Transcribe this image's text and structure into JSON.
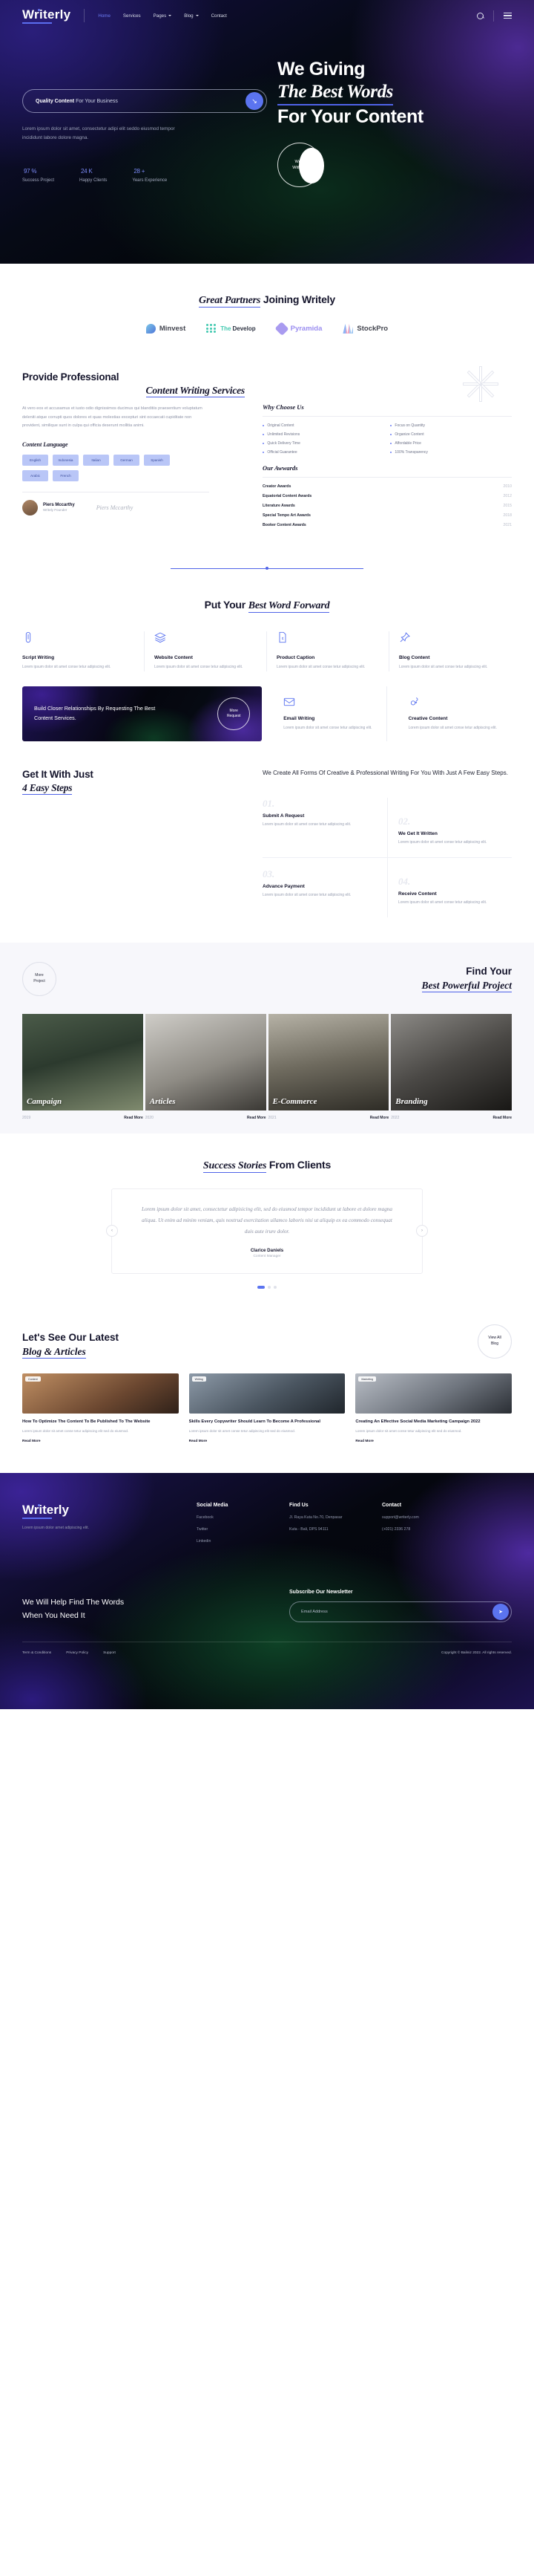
{
  "header": {
    "logo": "Writerly",
    "nav": [
      {
        "label": "Home",
        "active": true,
        "caret": false
      },
      {
        "label": "Services",
        "active": false,
        "caret": false
      },
      {
        "label": "Pages",
        "active": false,
        "caret": true
      },
      {
        "label": "Blog",
        "active": false,
        "caret": true
      },
      {
        "label": "Contact",
        "active": false,
        "caret": false
      }
    ],
    "search_icon": "search-icon",
    "menu_icon": "hamburger-icon"
  },
  "hero": {
    "search_value_bold": "Quality Content",
    "search_value_rest": " For Your Business",
    "submit_icon": "arrow-down-right",
    "description": "Lorem ipsum dolor sit amet, consectetur adipi elit seddo eiusmod tempor incididunt labore dolore magna.",
    "title_line1": "We Giving",
    "title_line2": "The Best Words",
    "title_line3": "For Your Content",
    "badge_line1": "Work",
    "badge_line2": "With Us",
    "stats": [
      {
        "value": "97",
        "unit": "%",
        "label": "Success Project"
      },
      {
        "value": "24",
        "unit": "K",
        "label": "Happy Clients"
      },
      {
        "value": "28",
        "unit": "+",
        "label": "Years Experience"
      }
    ]
  },
  "partners": {
    "title_italic": "Great Partners",
    "title_rest": " Joining Writely",
    "logos": [
      {
        "name": "Minvest"
      },
      {
        "name": "TheDevelop",
        "pre": "The",
        "post": "Develop"
      },
      {
        "name": "Pyramida"
      },
      {
        "name": "StockPro"
      }
    ]
  },
  "services": {
    "heading_line1": "Provide Professional",
    "heading_line2": "Content Writing Services",
    "paragraph": "At vero eos et accusamus et iusto odio dignissimos ducimus qui blanditiis praesentium voluptatum deleniti atque corrupti quos dolores et quas molestias excepturi sint occaecati cupiditate non provident, similique sunt in culpa qui officia deserunt mollitia animi.",
    "content_language_title": "Content Language",
    "languages": [
      "English",
      "Indonesia",
      "Italian",
      "German",
      "Spanish",
      "Arabic",
      "French"
    ],
    "author_name": "Piers Mccarthy",
    "author_role": "Writely Founder",
    "signature": "Piers Mccarthy"
  },
  "why_choose": {
    "title": "Why Choose Us",
    "items": [
      "Original Content",
      "Focus on Quantity",
      "Unlimited Revisions",
      "Organize Content",
      "Quick Delivery Time",
      "Affordable Price",
      "Official Guarantee",
      "100% Transparency"
    ]
  },
  "awards": {
    "title": "Our Awwards",
    "rows": [
      {
        "name": "Creator Awards",
        "year": "2010"
      },
      {
        "name": "Equatorial Content Awards",
        "year": "2012"
      },
      {
        "name": "Literature Awards",
        "year": "2015"
      },
      {
        "name": "Special Tempo Art Awards",
        "year": "2018"
      },
      {
        "name": "Booker Content Awards",
        "year": "2021"
      }
    ]
  },
  "best_word": {
    "title_rest": "Put Your ",
    "title_italic": "Best Word Forward",
    "cards": [
      {
        "icon": "paperclip-icon",
        "title": "Script Writing",
        "text": "Lorem ipsum dolor sit amet conse tetur adipiscing elit."
      },
      {
        "icon": "layers-icon",
        "title": "Website Content",
        "text": "Lorem ipsum dolor sit amet conse tetur adipiscing elit."
      },
      {
        "icon": "document-price-icon",
        "title": "Product Caption",
        "text": "Lorem ipsum dolor sit amet conse tetur adipiscing elit."
      },
      {
        "icon": "pin-icon",
        "title": "Blog Content",
        "text": "Lorem ipsum dolor sit amet conse tetur adipiscing elit."
      }
    ],
    "promo_text": "Build Closer Relationships By Requesting The Best Content Services.",
    "promo_btn_line1": "More",
    "promo_btn_line2": "Request",
    "cards2": [
      {
        "icon": "email-icon",
        "title": "Email Writing",
        "text": "Lorem ipsum dolor sit amet conse tetur adipiscing elit."
      },
      {
        "icon": "idea-icon",
        "title": "Creative Content",
        "text": "Lorem ipsum dolor sit amet conse tetur adipiscing elit."
      }
    ]
  },
  "steps": {
    "heading_line1": "Get It With Just",
    "heading_line2": "4 Easy Steps",
    "lead": "We Create All Forms Of Creative & Professional Writing For You With Just A Few Easy Steps.",
    "items": [
      {
        "num": "01.",
        "title": "Submit A Request",
        "text": "Lorem ipsum dolor sit amet conse tetur adipiscing elit."
      },
      {
        "num": "02.",
        "title": "We Get It Written",
        "text": "Lorem ipsum dolor sit amet conse tetur adipiscing elit."
      },
      {
        "num": "03.",
        "title": "Advance Payment",
        "text": "Lorem ipsum dolor sit amet conse tetur adipiscing elit."
      },
      {
        "num": "04.",
        "title": "Receive Content",
        "text": "Lorem ipsum dolor sit amet conse tetur adipiscing elit."
      }
    ]
  },
  "projects": {
    "more_line1": "More",
    "more_line2": "Project",
    "title_line1": "Find Your",
    "title_line2": "Best Powerful Project",
    "items": [
      {
        "caption": "Campaign",
        "year": "2019",
        "more": "Read More"
      },
      {
        "caption": "Articles",
        "year": "2020",
        "more": "Read More"
      },
      {
        "caption": "E-Commerce",
        "year": "2021",
        "more": "Read More"
      },
      {
        "caption": "Branding",
        "year": "2022",
        "more": "Read More"
      }
    ]
  },
  "testimonial": {
    "title_italic": "Success Stories",
    "title_rest": " From Clients",
    "quote": "Lorem ipsum dolor sit amet, consectetur adipisicing elit, sed do eiusmod tempor incididunt ut labore et dolore magna aliqua. Ut enim ad minim veniam, quis nostrud exercitation ullamco laboris nisi ut aliquip ex ea commodo consequat duis aute irure dolor.",
    "name": "Clarice Daniels",
    "role": "Content Manager",
    "prev_icon": "chevron-left-icon",
    "next_icon": "chevron-right-icon"
  },
  "blog": {
    "heading_line1": "Let's See Our Latest",
    "heading_line2": "Blog & Articles",
    "view_all_line1": "View All",
    "view_all_line2": "Blog",
    "posts": [
      {
        "tag": "Content",
        "title": "How To Optimize The Content To Be Published To The Website",
        "text": "Lorem ipsum dolor sit amet conse tetur adipiscing elit sed do eiusmod.",
        "more": "Read More"
      },
      {
        "tag": "Writing",
        "title": "Skills Every Copywriter Should Learn To Become A Professional",
        "text": "Lorem ipsum dolor sit amet conse tetur adipiscing elit sed do eiusmod.",
        "more": "Read More"
      },
      {
        "tag": "Marketing",
        "title": "Creating An Effective Social Media Marketing Campaign 2022",
        "text": "Lorem ipsum dolor sit amet conse tetur adipiscing elit sed do eiusmod.",
        "more": "Read More"
      }
    ]
  },
  "footer": {
    "logo": "Writerly",
    "tagline": "Lorem ipsum dolor amet adipiscing elit.",
    "columns": [
      {
        "title": "Social Media",
        "items": [
          "Facebook",
          "Twitter",
          "Linkedin"
        ]
      },
      {
        "title": "Find Us",
        "items": [
          "Jl. Raya Kuta No.70, Denpasar",
          "Kuta - Bali, DPS 94111"
        ]
      },
      {
        "title": "Contact",
        "items": [
          "support@writerly.com",
          "(+021) 2336 278"
        ]
      }
    ],
    "claim_line1": "We Will Help Find The Words",
    "claim_line2": "When You Need It",
    "subscribe_title": "Subscribe Our Newsletter",
    "email_placeholder": "Email Address",
    "send_icon": "send-icon",
    "links": [
      "Term & Conditions",
      "Privacy Policy",
      "Support"
    ],
    "copyright": "Copyright © Baliniz 2022. All rights reserved."
  },
  "colors": {
    "accent": "#5b74f0",
    "dark": "#05070f",
    "tag_bg": "#b9c6f7"
  }
}
